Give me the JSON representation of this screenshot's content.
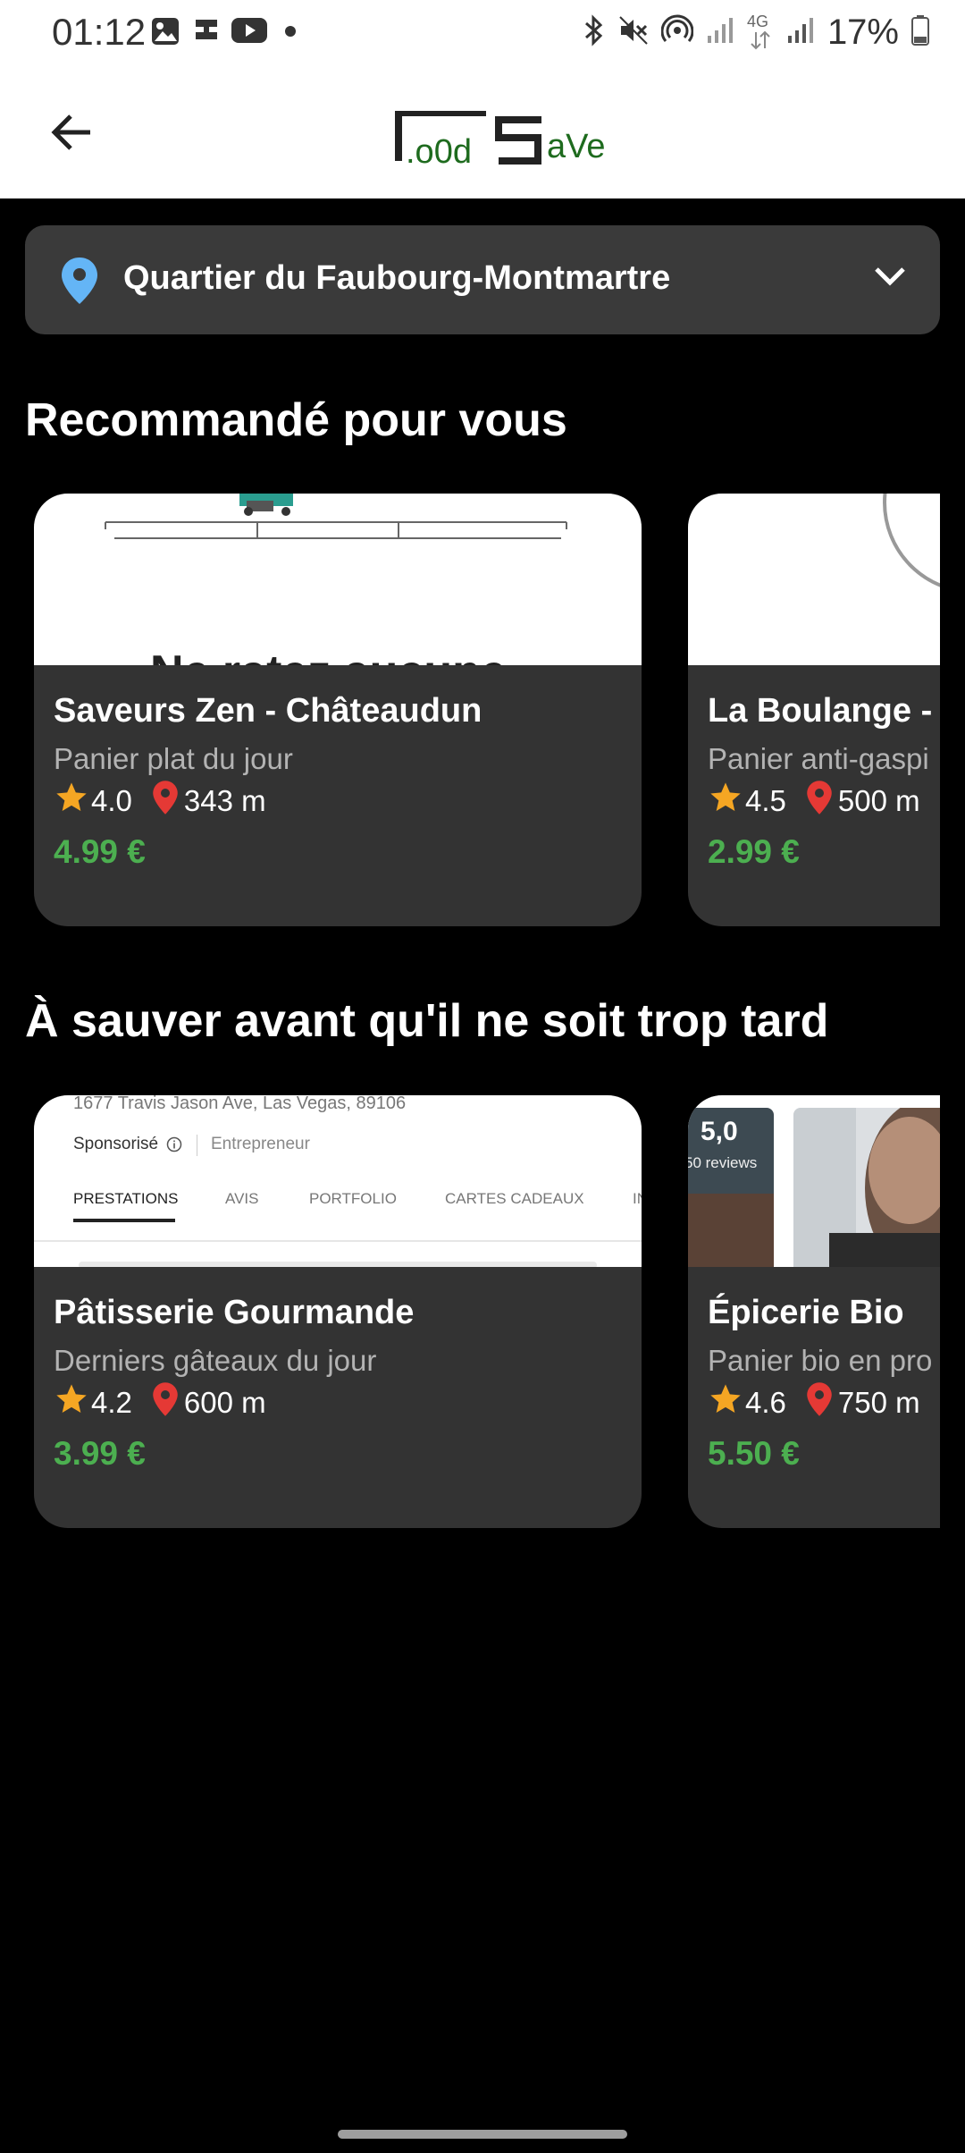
{
  "status_bar": {
    "time": "01:12",
    "left_icons": [
      "gallery-icon",
      "app-icon",
      "youtube-icon",
      "dot-icon"
    ],
    "right_icons": [
      "bluetooth-icon",
      "mute-icon",
      "hotspot-icon",
      "signal-icon",
      "4g-icon",
      "signal-icon",
      "battery-icon"
    ],
    "battery": "17%",
    "network": "4G"
  },
  "header": {
    "back_icon": "arrow-left-icon",
    "logo_text": "FoOd SaVe."
  },
  "location": {
    "label": "Quartier du Faubourg-Montmartre",
    "pin_color": "#64b5f6"
  },
  "sections": [
    {
      "title": "Recommandé pour vous",
      "cards": [
        {
          "name": "Saveurs Zen - Châteaudun",
          "description": "Panier plat du jour",
          "rating": "4.0",
          "distance": "343 m",
          "price": "4.99 €",
          "image_text": "Ne ratez aucune"
        },
        {
          "name": "La Boulange - ",
          "description": "Panier anti-gaspi",
          "rating": "4.5",
          "distance": "500 m",
          "price": "2.99 €"
        }
      ]
    },
    {
      "title": "À sauver avant qu'il ne soit trop tard",
      "cards": [
        {
          "name": "Pâtisserie Gourmande",
          "description": "Derniers gâteaux du jour",
          "rating": "4.2",
          "distance": "600 m",
          "price": "3.99 €",
          "image_address": "1677 Travis Jason Ave, Las Vegas, 89106",
          "image_sponsored": "Sponsorisé",
          "image_entrepreneur": "Entrepreneur",
          "image_tabs": [
            "PRESTATIONS",
            "AVIS",
            "PORTFOLIO",
            "CARTES CADEAUX",
            "IN"
          ]
        },
        {
          "name": "Épicerie Bio",
          "description": "Panier bio en pro",
          "rating": "4.6",
          "distance": "750 m",
          "price": "5.50 €",
          "image_score": "5,0",
          "image_reviews": "50 reviews"
        }
      ]
    }
  ],
  "colors": {
    "price": "#4caf50",
    "star": "#f5a623",
    "distance_pin": "#e53935",
    "card_bg": "#333333",
    "logo_green": "#1e6b1e"
  }
}
